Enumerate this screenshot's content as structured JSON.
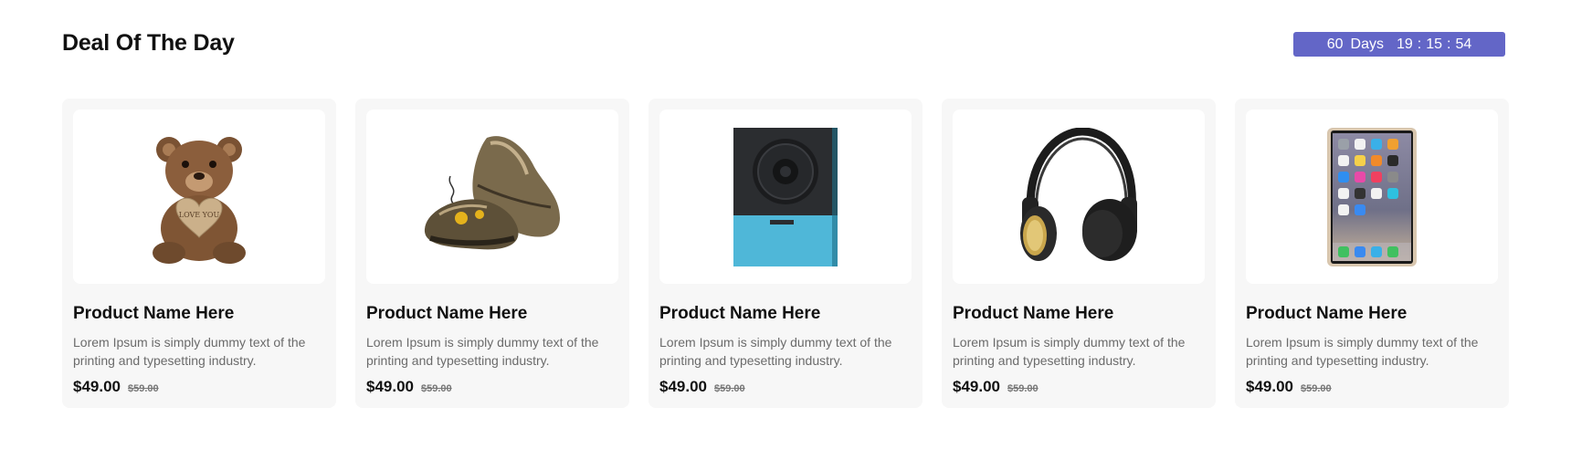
{
  "section": {
    "title": "Deal Of The Day"
  },
  "timer": {
    "days": "60",
    "days_label": "Days",
    "hours": "19",
    "minutes": "15",
    "seconds": "54",
    "separator": ":",
    "background": "#6366c7"
  },
  "products": [
    {
      "image": "teddy-bear",
      "image_caption": "LOVE YOU",
      "name": "Product Name Here",
      "description": "Lorem Ipsum is simply dummy text of the printing and typesetting industry.",
      "price": "$49.00",
      "old_price": "$59.00"
    },
    {
      "image": "sneakers",
      "name": "Product Name Here",
      "description": "Lorem Ipsum is simply dummy text of the printing and typesetting industry.",
      "price": "$49.00",
      "old_price": "$59.00"
    },
    {
      "image": "speaker",
      "name": "Product Name Here",
      "description": "Lorem Ipsum is simply dummy text of the printing and typesetting industry.",
      "price": "$49.00",
      "old_price": "$59.00"
    },
    {
      "image": "headphones",
      "name": "Product Name Here",
      "description": "Lorem Ipsum is simply dummy text of the printing and typesetting industry.",
      "price": "$49.00",
      "old_price": "$59.00"
    },
    {
      "image": "smartphone",
      "name": "Product Name Here",
      "description": "Lorem Ipsum is simply dummy text of the printing and typesetting industry.",
      "price": "$49.00",
      "old_price": "$59.00"
    }
  ]
}
